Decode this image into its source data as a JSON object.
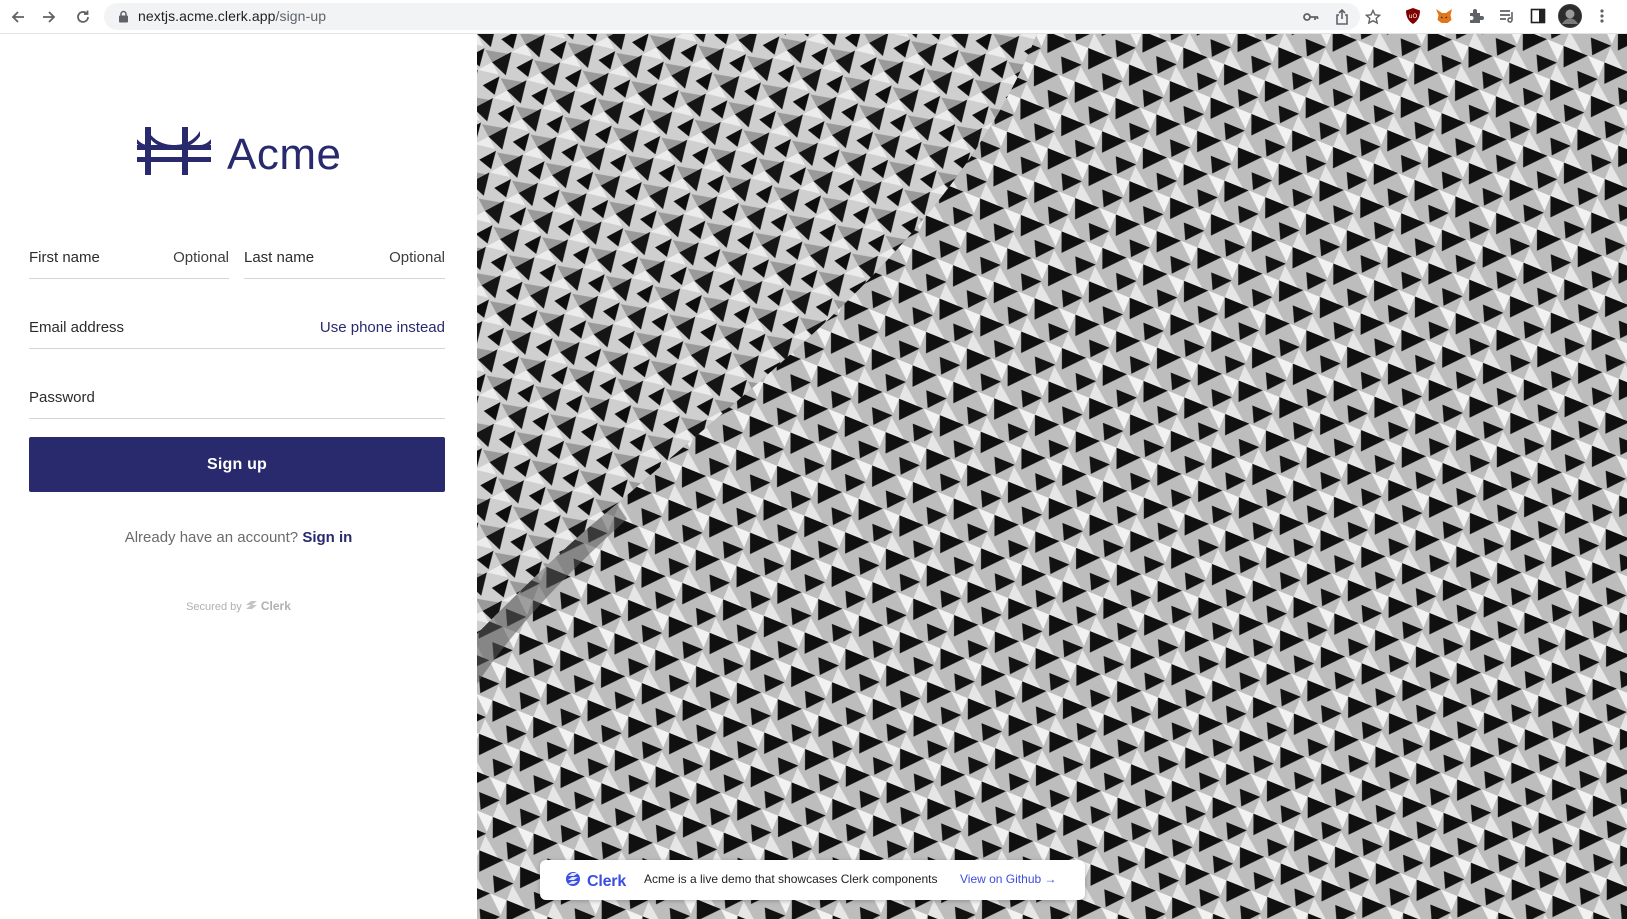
{
  "browser": {
    "url_host": "nextjs.acme.clerk.app",
    "url_path": "/sign-up"
  },
  "brand": {
    "name": "Acme",
    "color": "#292a6e"
  },
  "form": {
    "first_name_label": "First name",
    "first_name_hint": "Optional",
    "last_name_label": "Last name",
    "last_name_hint": "Optional",
    "email_label": "Email address",
    "email_action": "Use phone instead",
    "password_label": "Password",
    "submit_label": "Sign up",
    "already_text": "Already have an account?",
    "signin_link": "Sign in",
    "secured_by": "Secured by",
    "secured_brand": "Clerk"
  },
  "banner": {
    "brand": "Clerk",
    "message": "Acme is a live demo that showcases Clerk components",
    "link": "View on Github →",
    "accent": "#3b4fe0"
  },
  "icons": [
    "back-icon",
    "forward-icon",
    "reload-icon",
    "lock-icon",
    "key-icon",
    "share-icon",
    "star-icon",
    "ublock-icon",
    "metamask-icon",
    "extensions-icon",
    "reading-list-icon",
    "side-panel-icon",
    "profile-avatar",
    "menu-icon"
  ]
}
